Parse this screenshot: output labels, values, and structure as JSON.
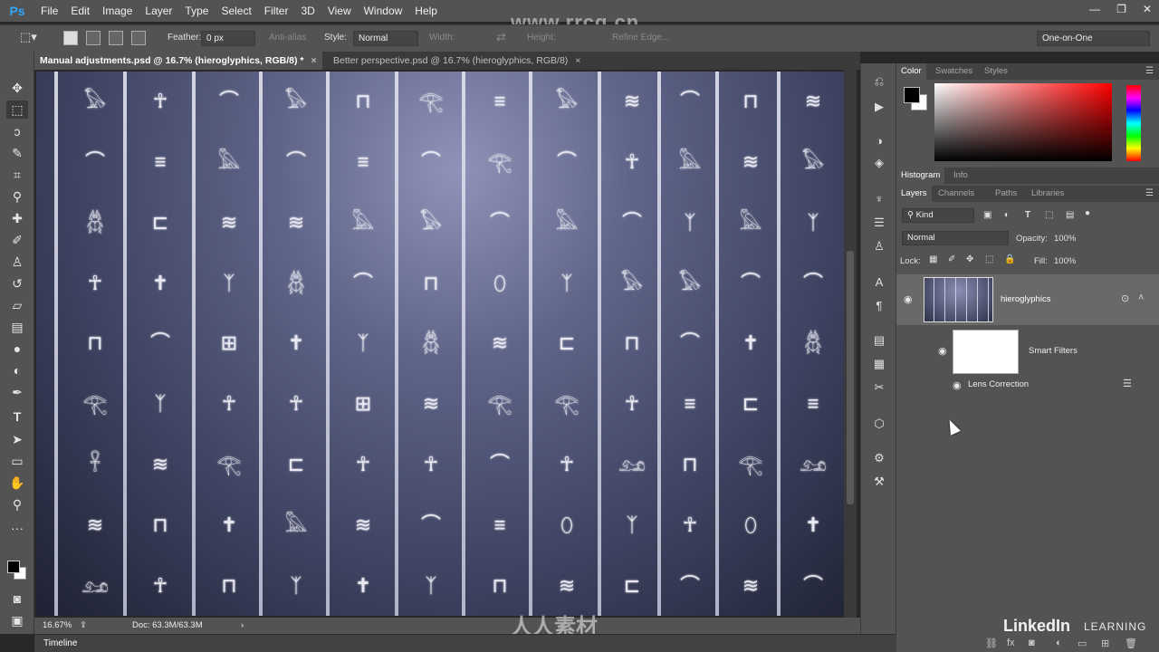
{
  "app": {
    "logo": "Ps",
    "watermark": "www.rrcg.cn",
    "brand": "LinkedIn",
    "brand_suffix": "LEARNING",
    "bottom_logo": "人人素材"
  },
  "menu": [
    "File",
    "Edit",
    "Image",
    "Layer",
    "Type",
    "Select",
    "Filter",
    "3D",
    "View",
    "Window",
    "Help"
  ],
  "window_controls": [
    "—",
    "❐",
    "✕"
  ],
  "options": {
    "feather_label": "Feather:",
    "feather_value": "0 px",
    "anti_alias": "Anti-alias",
    "style_label": "Style:",
    "style_value": "Normal",
    "width_label": "Width:",
    "height_label": "Height:",
    "refine_edge": "Refine Edge...",
    "workspace": "One-on-One"
  },
  "tabs": [
    {
      "label": "Manual adjustments.psd @ 16.7% (hieroglyphics, RGB/8) *",
      "active": true
    },
    {
      "label": "Better perspective.psd @ 16.7% (hieroglyphics, RGB/8)",
      "active": false
    }
  ],
  "status": {
    "zoom": "16.67%",
    "doc": "Doc: 63.3M/63.3M"
  },
  "timeline": {
    "label": "Timeline"
  },
  "panels": {
    "color_tabs": [
      "Color",
      "Swatches",
      "Styles"
    ],
    "histogram_tabs": [
      "Histogram",
      "Info"
    ],
    "layers_tabs": [
      "Layers",
      "Channels",
      "Paths",
      "Libraries"
    ],
    "kind": "Kind",
    "blend_mode": "Normal",
    "opacity_label": "Opacity:",
    "opacity_value": "100%",
    "lock_label": "Lock:",
    "fill_label": "Fill:",
    "fill_value": "100%"
  },
  "layers": {
    "main": "hieroglyphics",
    "smart_filters": "Smart Filters",
    "filter": "Lens Correction"
  },
  "colors": {
    "accent": "#31a8ff",
    "panel_bg": "#535353",
    "dark_bg": "#282828",
    "selected_layer": "#696969"
  },
  "icons": [
    "move-icon",
    "marquee-icon",
    "lasso-icon",
    "quick-select-icon",
    "crop-icon",
    "eyedropper-icon",
    "healing-icon",
    "brush-icon",
    "stamp-icon",
    "history-brush-icon",
    "eraser-icon",
    "gradient-icon",
    "blur-icon",
    "dodge-icon",
    "pen-icon",
    "type-icon",
    "path-select-icon",
    "shape-icon",
    "hand-icon",
    "zoom-icon",
    "more-icon",
    "eye-icon"
  ]
}
